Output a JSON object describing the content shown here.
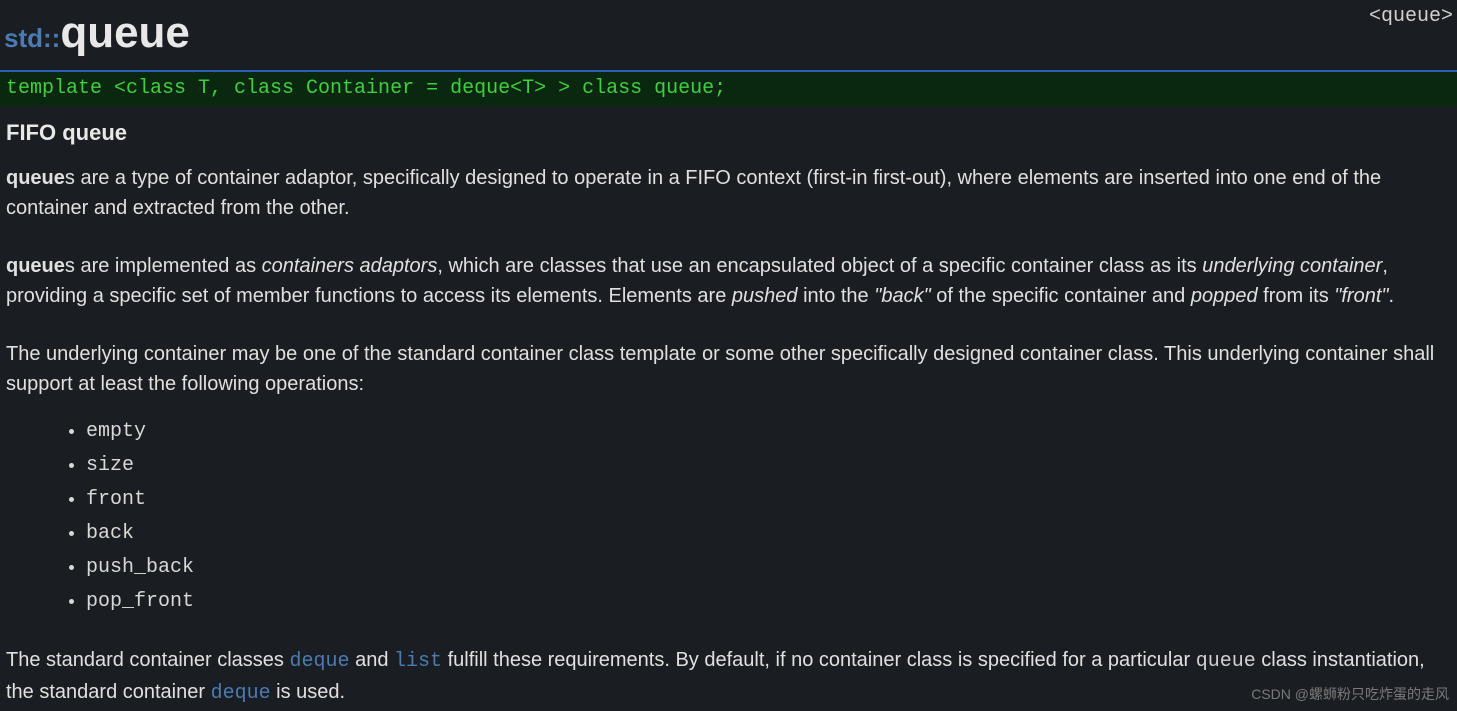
{
  "header_link": "<queue>",
  "title": {
    "ns": "std::",
    "name": "queue"
  },
  "template_decl": "template <class T, class Container = deque<T> > class queue;",
  "subtitle": "FIFO queue",
  "para1_b1": "queue",
  "para1_rest": "s are a type of container adaptor, specifically designed to operate in a FIFO context (first-in first-out), where elements are inserted into one end of the container and extracted from the other.",
  "para2_b1": "queue",
  "para2_t1": "s are implemented as ",
  "para2_i1": "containers adaptors",
  "para2_t2": ", which are classes that use an encapsulated object of a specific container class as its ",
  "para2_i2": "underlying container",
  "para2_t3": ", providing a specific set of member functions to access its elements. Elements are ",
  "para2_i3": "pushed",
  "para2_t4": " into the ",
  "para2_i4": "\"back\"",
  "para2_t5": " of the specific container and ",
  "para2_i5": "popped",
  "para2_t6": " from its ",
  "para2_i6": "\"front\"",
  "para2_t7": ".",
  "para3": "The underlying container may be one of the standard container class template or some other specifically designed container class. This underlying container shall support at least the following operations:",
  "ops": [
    "empty",
    "size",
    "front",
    "back",
    "push_back",
    "pop_front"
  ],
  "para4_t1": "The standard container classes ",
  "para4_l1": "deque",
  "para4_t2": " and ",
  "para4_l2": "list",
  "para4_t3": " fulfill these requirements. By default, if no container class is specified for a particular ",
  "para4_m1": "queue",
  "para4_t4": " class instantiation, the standard container ",
  "para4_l3": "deque",
  "para4_t5": " is used.",
  "watermark": "CSDN @螺蛳粉只吃炸蛋的走风"
}
